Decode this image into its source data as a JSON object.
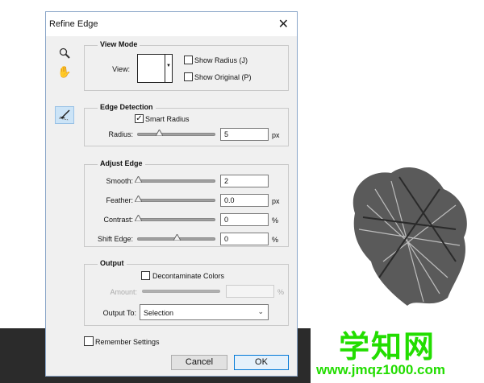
{
  "dialog": {
    "title": "Refine Edge"
  },
  "view_mode": {
    "legend": "View Mode",
    "view_label": "View:",
    "show_radius": "Show Radius (J)",
    "show_original": "Show Original (P)",
    "show_radius_checked": false,
    "show_original_checked": false
  },
  "edge_detection": {
    "legend": "Edge Detection",
    "smart_radius": "Smart Radius",
    "smart_radius_checked": true,
    "radius_label": "Radius:",
    "radius_value": "5",
    "radius_unit": "px",
    "radius_slider_fraction": 0.27
  },
  "adjust_edge": {
    "legend": "Adjust Edge",
    "rows": [
      {
        "label": "Smooth:",
        "value": "2",
        "unit": "",
        "fraction": 0.0
      },
      {
        "label": "Feather:",
        "value": "0.0",
        "unit": "px",
        "fraction": 0.0
      },
      {
        "label": "Contrast:",
        "value": "0",
        "unit": "%",
        "fraction": 0.0
      },
      {
        "label": "Shift Edge:",
        "value": "0",
        "unit": "%",
        "fraction": 0.5
      }
    ]
  },
  "output": {
    "legend": "Output",
    "decontaminate": "Decontaminate Colors",
    "decontaminate_checked": false,
    "amount_label": "Amount:",
    "amount_value": "",
    "amount_unit": "%",
    "output_to_label": "Output To:",
    "output_to_value": "Selection"
  },
  "remember_settings": "Remember Settings",
  "buttons": {
    "cancel": "Cancel",
    "ok": "OK"
  },
  "watermark": {
    "title": "学知网",
    "url": "www.jmqz1000.com"
  },
  "colors": {
    "watermark": "#22dd00",
    "selected_tool": "#cce4f7"
  }
}
